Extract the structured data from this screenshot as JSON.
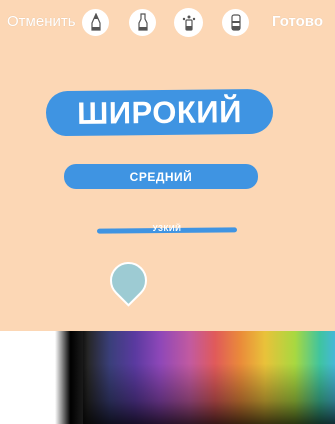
{
  "toolbar": {
    "cancel_label": "Отменить",
    "done_label": "Готово",
    "tools": [
      "pen-icon",
      "marker-icon",
      "neon-icon",
      "eraser-icon"
    ]
  },
  "brush_sizes": {
    "wide_label": "ШИРОКИЙ",
    "medium_label": "СРЕДНИЙ",
    "narrow_label": "УЗКИЙ"
  },
  "colors": {
    "canvas": "#fcd7b5",
    "stroke": "#3f94e2",
    "selected": "#9dcbd3"
  }
}
